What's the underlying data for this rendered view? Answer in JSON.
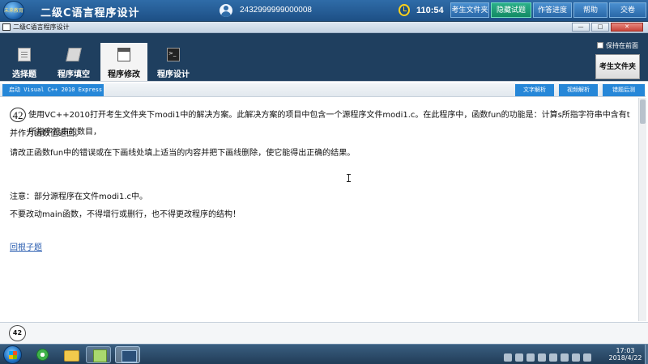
{
  "header": {
    "logo_text": "未来教育",
    "app_title": "二级C语言程序设计",
    "examinee_id": "2432999999000008",
    "timer": "110:54",
    "buttons": {
      "folder": "考生文件夹",
      "hide": "隐藏试题",
      "progress": "作答进度",
      "help": "帮助",
      "submit": "交卷"
    }
  },
  "window": {
    "title": "二级C语言程序设计",
    "controls": {
      "minimize": "—",
      "maximize": "□",
      "close": "✕"
    }
  },
  "tabs": [
    {
      "label": "选择题"
    },
    {
      "label": "程序填空"
    },
    {
      "label": "程序修改",
      "active": true
    },
    {
      "label": "程序设计"
    }
  ],
  "toolbar": {
    "keep_front": "保持在前面",
    "folder_button": "考生文件夹"
  },
  "subbar": {
    "launch": "启动 Visual C++ 2010 Express",
    "text_analysis": "文字解析",
    "video_analysis": "视频解析",
    "error_retrain": "错题后测"
  },
  "question": {
    "number": "42",
    "line1": "使用VC++2010打开考生文件夹下modi1中的解决方案。此解决方案的项目中包含一个源程序文件modi1.c。在此程序中，函数fun的功能是：计算s所指字符串中含有t所指字符串的数目，",
    "line2": "并作为函数值返回。",
    "line3": "请改正函数fun中的错误或在下画线处填上适当的内容并把下画线删除，使它能得出正确的结果。",
    "line4": "注意：部分源程序在文件modi1.c中。",
    "line5": "不要改动main函数，不得增行或删行，也不得更改程序的结构！",
    "back_link": "回根子题"
  },
  "navigator": {
    "current": "42"
  },
  "taskbar": {
    "time": "17:03",
    "date": "2018/4/22"
  },
  "colors": {
    "header_blue": "#1d4f85",
    "accent_blue": "#2687d8",
    "hide_green": "#138a63"
  }
}
